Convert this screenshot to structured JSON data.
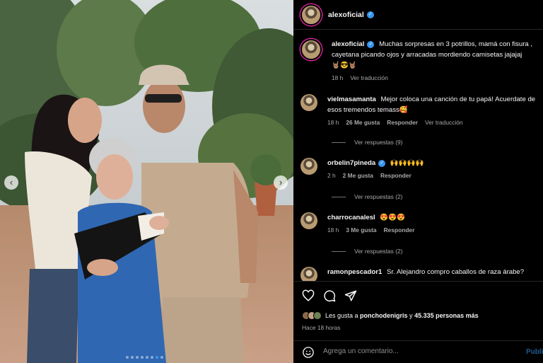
{
  "post": {
    "photo_alt": "",
    "carousel": {
      "prev_icon": "chevron-left-icon",
      "next_icon": "chevron-right-icon",
      "total": 8,
      "active": 6
    }
  },
  "header": {
    "username": "alexoficial",
    "verified": true
  },
  "caption": {
    "author": "alexoficial",
    "text": "Muchas sorpresas en 3 potrillos, mamá con fisura , cayetana picando ojos y arracadas mordiendo camisetas jajajaj",
    "emojis": "🤘🏽😎🤘🏽",
    "time": "18 h",
    "translate": "Ver traducción"
  },
  "comments": [
    {
      "author": "vielmasamanta",
      "text": "Mejor coloca una canción de tu papá! Acuerdate de esos tremendos temass🥰",
      "time": "18 h",
      "likes": "26 Me gusta",
      "reply": "Responder",
      "translate": "Ver traducción",
      "view_replies": "Ver respuestas (9)"
    },
    {
      "author": "orbelin7pineda",
      "text": "🙌🙌🙌🙌",
      "time": "2 h",
      "likes": "2 Me gusta",
      "reply": "Responder",
      "view_replies": "Ver respuestas (2)"
    },
    {
      "author": "charrocanalesl",
      "text": "😍😍😍",
      "time": "18 h",
      "likes": "3 Me gusta",
      "reply": "Responder",
      "view_replies": "Ver respuestas (2)"
    },
    {
      "author": "ramonpescador1",
      "text": "Sr. Alejandro compro caballos de raza árabe?"
    }
  ],
  "actions": {
    "like_icon": "heart-icon",
    "comment_icon": "comment-bubble-icon",
    "share_icon": "paper-plane-icon"
  },
  "likes": {
    "prefix": "Les gusta a ",
    "user": "ponchodenigris",
    "middle": " y ",
    "count": "45.335 personas más"
  },
  "time_ago": "Hace 18 horas",
  "add_comment": {
    "placeholder": "Agrega un comentario...",
    "post_label": "Publicar",
    "emoji_icon": "smiley-icon"
  },
  "colors": {
    "accent": "#3897f0",
    "background": "#000000",
    "secondary_text": "#a8a8a8"
  }
}
